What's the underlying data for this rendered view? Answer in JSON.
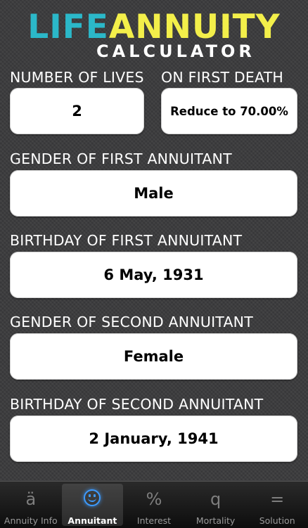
{
  "logo": {
    "life": "LIFE",
    "annuity": "ANNUITY",
    "calculator": "CALCULATOR"
  },
  "fields": {
    "number_of_lives": {
      "label": "NUMBER OF LIVES",
      "value": "2"
    },
    "on_first_death": {
      "label": "ON FIRST DEATH",
      "value": "Reduce to 70.00%"
    },
    "gender_first": {
      "label": "GENDER OF FIRST ANNUITANT",
      "value": "Male"
    },
    "birthday_first": {
      "label": "BIRTHDAY OF FIRST ANNUITANT",
      "value": "6 May, 1931"
    },
    "gender_second": {
      "label": "GENDER OF SECOND ANNUITANT",
      "value": "Female"
    },
    "birthday_second": {
      "label": "BIRTHDAY OF SECOND ANNUITANT",
      "value": "2 January, 1941"
    }
  },
  "tabs": [
    {
      "label": "Annuity Info",
      "icon": "ä",
      "icon_name": "a-umlaut-icon",
      "active": false
    },
    {
      "label": "Annuitant",
      "icon": "",
      "icon_name": "smiley-icon",
      "active": true
    },
    {
      "label": "Interest",
      "icon": "%",
      "icon_name": "percent-icon",
      "active": false
    },
    {
      "label": "Mortality",
      "icon": "q",
      "icon_name": "q-icon",
      "active": false
    },
    {
      "label": "Solution",
      "icon": "=",
      "icon_name": "equals-icon",
      "active": false
    }
  ],
  "colors": {
    "life": "#2bb8c9",
    "annuity": "#f3ef4a",
    "active_icon": "#3d9bff"
  }
}
